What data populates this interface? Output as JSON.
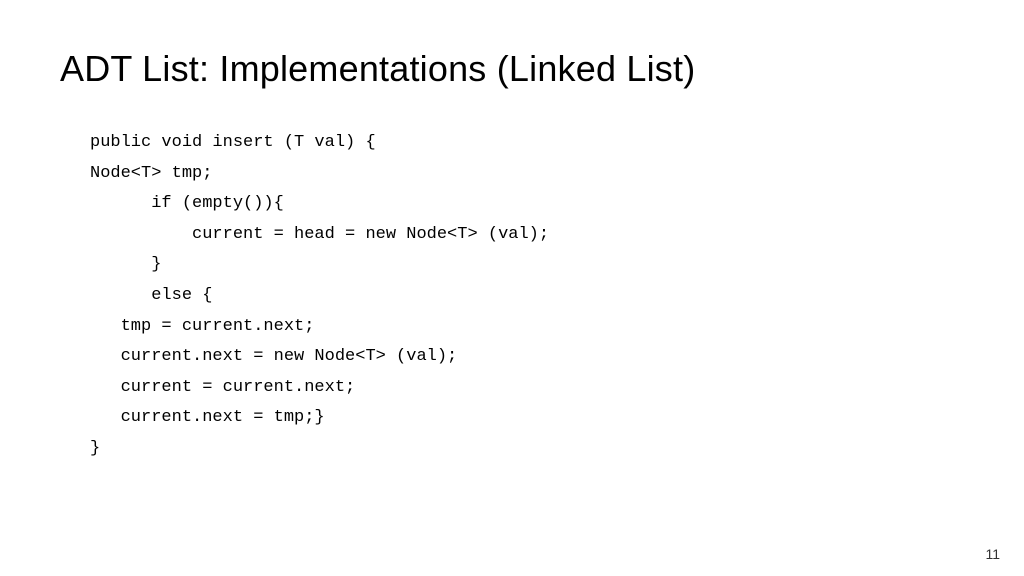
{
  "title": "ADT List: Implementations (Linked List)",
  "code": {
    "l0": "public void insert (T val) {",
    "l1": "",
    "l2": "Node<T> tmp;",
    "l3": "      if (empty()){",
    "l4": "          current = head = new Node<T> (val);",
    "l5": "      }",
    "l6": "      else {",
    "l7": "   tmp = current.next;",
    "l8": "   current.next = new Node<T> (val);",
    "l9": "   current = current.next;",
    "l10": "   current.next = tmp;}",
    "l11": "}"
  },
  "pageNumber": "11"
}
